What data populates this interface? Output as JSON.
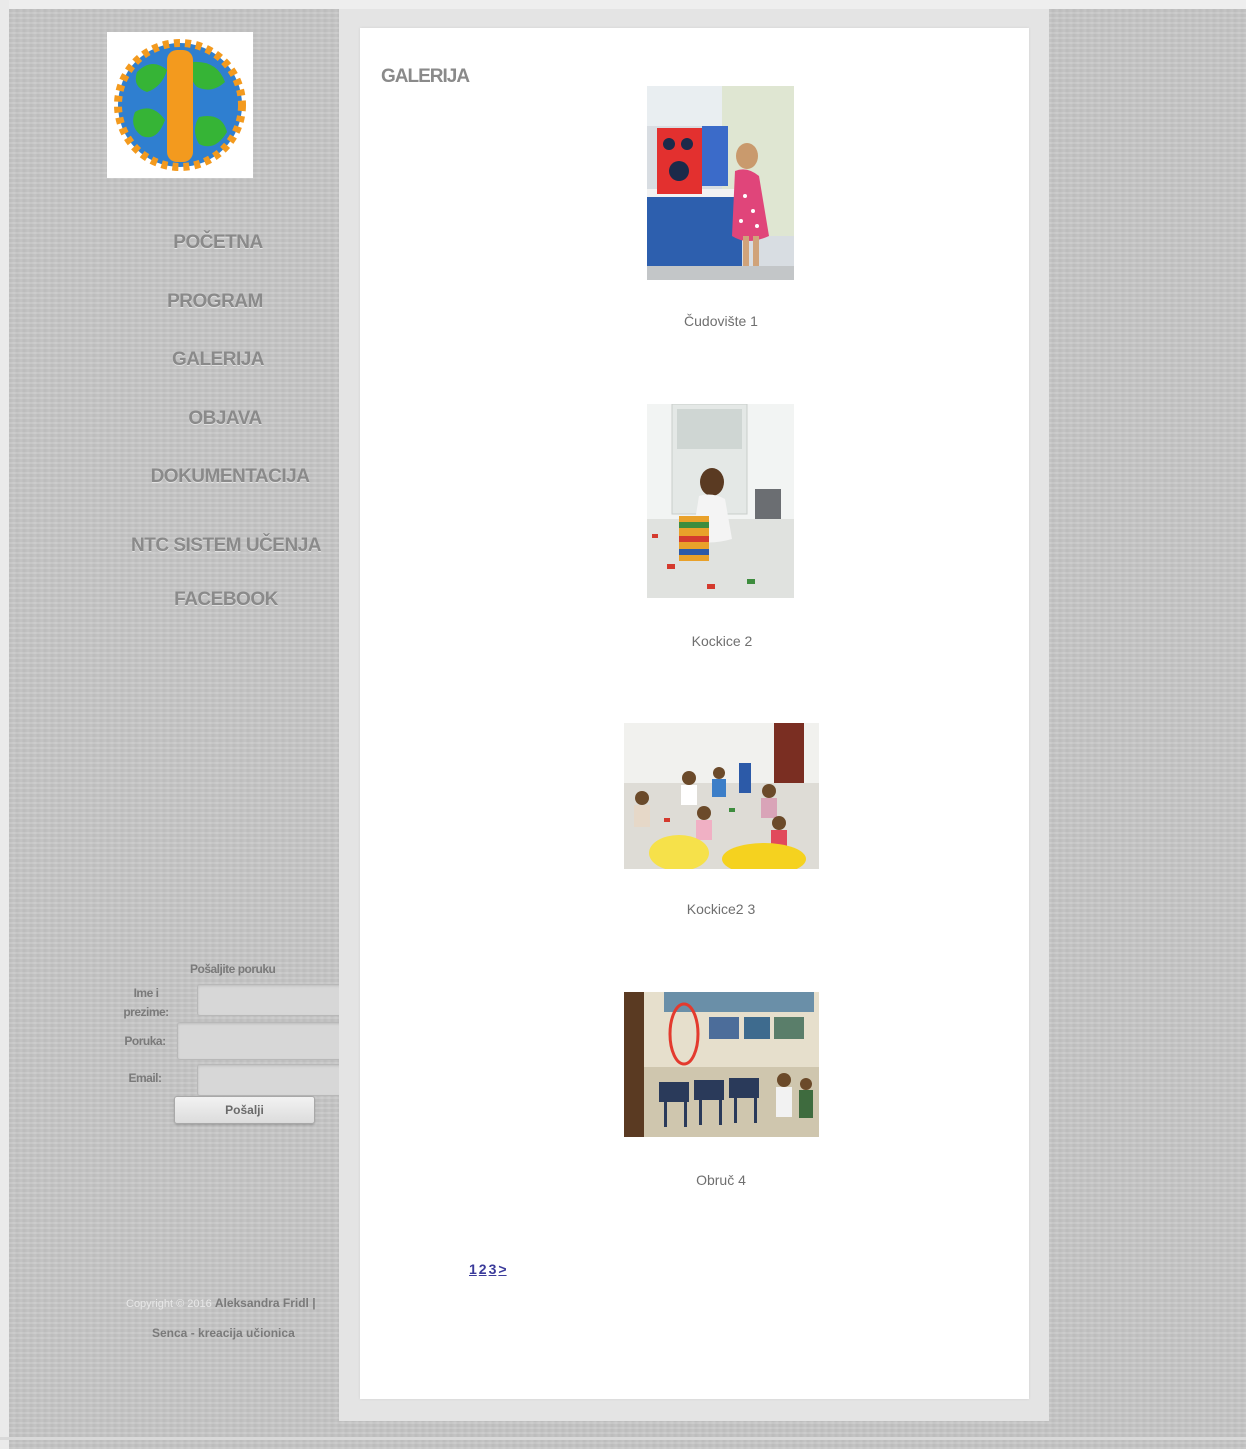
{
  "sidebar": {
    "logo_alt": "Logo",
    "nav": [
      {
        "label": "POČETNA"
      },
      {
        "label": "PROGRAM"
      },
      {
        "label": "GALERIJA"
      },
      {
        "label": "OBJAVA"
      },
      {
        "label": "DOKUMENTACIJA"
      },
      {
        "label": "NTC SISTEM UČENJA"
      },
      {
        "label": "FACEBOOK"
      }
    ],
    "form": {
      "title": "Pošaljite poruku",
      "name_label": "Ime i prezime:",
      "message_label": "Poruka:",
      "email_label": "Email:",
      "send_label": "Pošalji"
    },
    "copyright": {
      "prefix": "Copyright © 2016",
      "author": "Aleksandra Fridl |",
      "line2": "Senca - kreacija učionica"
    }
  },
  "main": {
    "title": "GALERIJA",
    "items": [
      {
        "caption": "Čudovište 1"
      },
      {
        "caption": "Kockice 2"
      },
      {
        "caption": "Kockice2 3"
      },
      {
        "caption": "Obruč 4"
      }
    ],
    "pager": [
      "1",
      "2",
      "3",
      ">"
    ]
  }
}
